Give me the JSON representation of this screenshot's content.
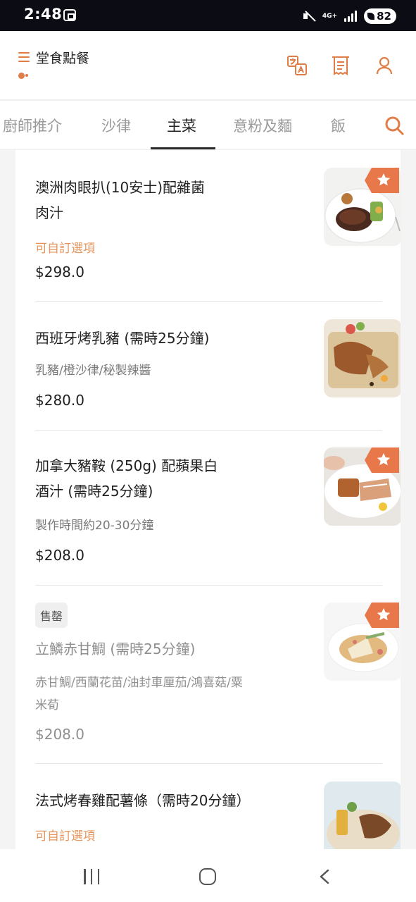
{
  "status_bar": {
    "time": "2:48",
    "network": "4G+",
    "battery": "82"
  },
  "header": {
    "title": "堂食點餐"
  },
  "tabs": [
    {
      "label": "廚師推介",
      "active": false
    },
    {
      "label": "沙律",
      "active": false
    },
    {
      "label": "主菜",
      "active": true
    },
    {
      "label": "意粉及麵",
      "active": false
    },
    {
      "label": "飯",
      "active": false
    }
  ],
  "menu_items": [
    {
      "name_line1": "澳洲肉眼扒(10安士)配雜菌",
      "name_line2": "肉汁",
      "option": "可自訂選項",
      "price": "$298.0",
      "featured": true
    },
    {
      "name_line1": "西班牙烤乳豬 (需時25分鐘)",
      "description": "乳豬/橙沙律/秘製辣醬",
      "price": "$280.0",
      "featured": false
    },
    {
      "name_line1": "加拿大豬鞍 (250g) 配蘋果白",
      "name_line2": "酒汁 (需時25分鐘)",
      "description": "製作時間約20-30分鐘",
      "price": "$208.0",
      "featured": true
    },
    {
      "badge": "售罄",
      "name_line1": "立鱗赤甘鯛 (需時25分鐘)",
      "description_line1": "赤甘鯛/西蘭花苗/油封車厘茄/鴻喜菇/粟",
      "description_line2": "米荀",
      "price": "$208.0",
      "featured": true,
      "sold_out": true
    },
    {
      "name_line1": "法式烤春雞配薯條（需時20分鐘）",
      "option": "可自訂選項",
      "featured": false
    }
  ],
  "colors": {
    "accent": "#e07c45",
    "option_text": "#e5955c",
    "status_bar": "#0b0c14"
  },
  "icons": {
    "menu": "menu-icon",
    "location": "location-icon",
    "translate": "translate-icon",
    "receipt": "receipt-icon",
    "account": "user-icon",
    "search": "search-icon",
    "featured": "star-icon"
  }
}
